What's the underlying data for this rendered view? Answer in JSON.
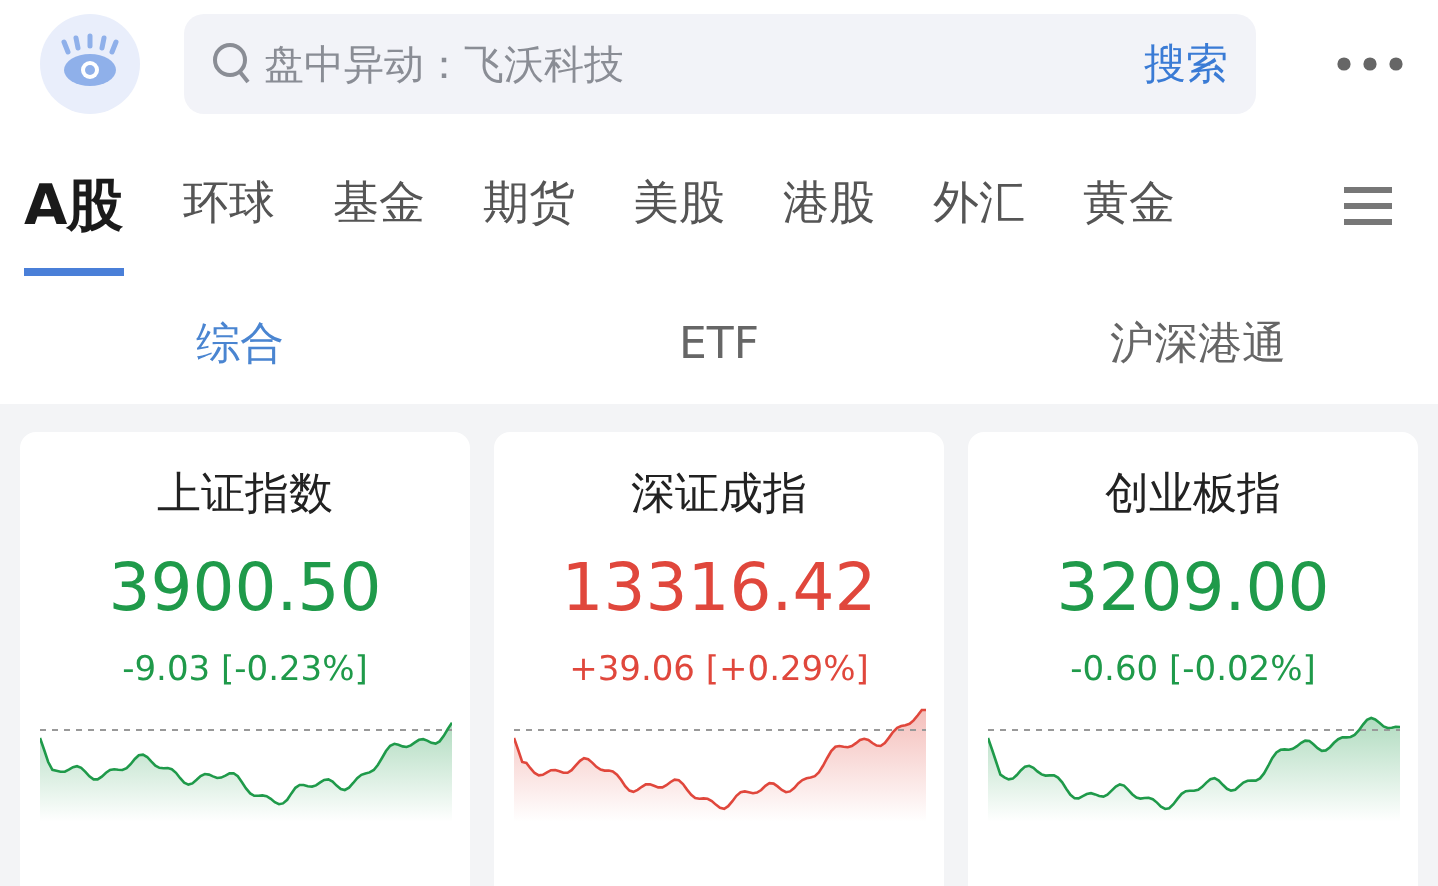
{
  "search": {
    "placeholder": "盘中异动：飞沃科技",
    "button": "搜索"
  },
  "tabs": [
    {
      "label": "A股",
      "selected": true
    },
    {
      "label": "环球",
      "selected": false
    },
    {
      "label": "基金",
      "selected": false
    },
    {
      "label": "期货",
      "selected": false
    },
    {
      "label": "美股",
      "selected": false
    },
    {
      "label": "港股",
      "selected": false
    },
    {
      "label": "外汇",
      "selected": false
    },
    {
      "label": "黄金",
      "selected": false
    }
  ],
  "subtabs": [
    {
      "label": "综合",
      "selected": true
    },
    {
      "label": "ETF",
      "selected": false
    },
    {
      "label": "沪深港通",
      "selected": false
    }
  ],
  "indices": [
    {
      "name": "上证指数",
      "value": "3900.50",
      "change": "-9.03 [-0.23%]",
      "kind": "down"
    },
    {
      "name": "深证成指",
      "value": "13316.42",
      "change": "+39.06 [+0.29%]",
      "kind": "up"
    },
    {
      "name": "创业板指",
      "value": "3209.00",
      "change": "-0.60 [-0.02%]",
      "kind": "down"
    }
  ]
}
